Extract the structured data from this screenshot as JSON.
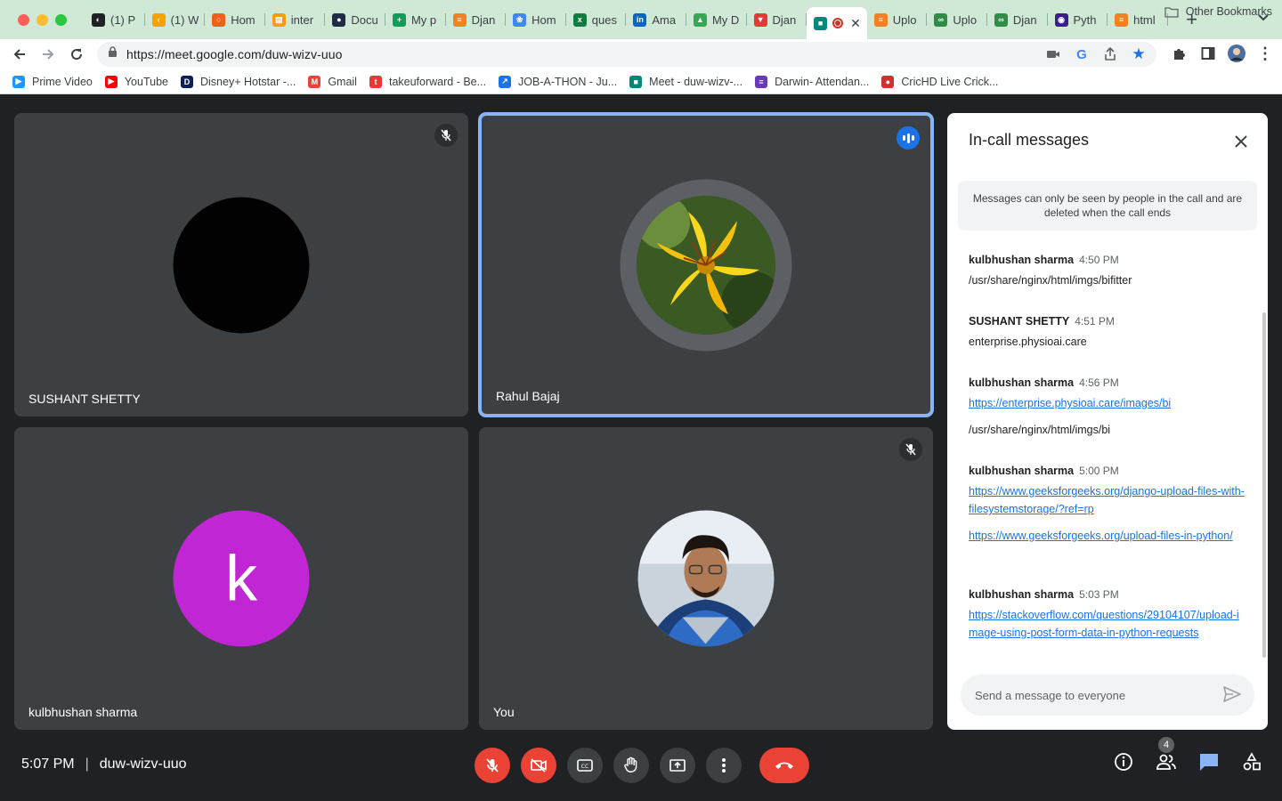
{
  "tabs": [
    {
      "title": "(1) P",
      "favicon_color": "#202124",
      "favicon_glyph": "◐"
    },
    {
      "title": "(1) W",
      "favicon_color": "#f4a300",
      "favicon_glyph": "‹"
    },
    {
      "title": "Hom",
      "favicon_color": "#f25f1a",
      "favicon_glyph": "○"
    },
    {
      "title": "inter",
      "favicon_color": "#f59e0b",
      "favicon_glyph": "▤"
    },
    {
      "title": "Docu",
      "favicon_color": "#1f2a44",
      "favicon_glyph": "●"
    },
    {
      "title": "My p",
      "favicon_color": "#0f9d58",
      "favicon_glyph": "+"
    },
    {
      "title": "Djan",
      "favicon_color": "#f48024",
      "favicon_glyph": "≡"
    },
    {
      "title": "Hom",
      "favicon_color": "#4285f4",
      "favicon_glyph": "❀"
    },
    {
      "title": "ques",
      "favicon_color": "#107c41",
      "favicon_glyph": "x"
    },
    {
      "title": "Ama",
      "favicon_color": "#0a66c2",
      "favicon_glyph": "in"
    },
    {
      "title": "My D",
      "favicon_color": "#34a853",
      "favicon_glyph": "▲"
    },
    {
      "title": "Djan",
      "favicon_color": "#e53935",
      "favicon_glyph": "▼"
    },
    {
      "title": "",
      "favicon_color": "#00897b",
      "favicon_glyph": "■",
      "active": true
    },
    {
      "title": "Uplo",
      "favicon_color": "#f48024",
      "favicon_glyph": "≡"
    },
    {
      "title": "Uplo",
      "favicon_color": "#2f8d46",
      "favicon_glyph": "∞"
    },
    {
      "title": "Djan",
      "favicon_color": "#2f8d46",
      "favicon_glyph": "∞"
    },
    {
      "title": "Pyth",
      "favicon_color": "#3b1c8c",
      "favicon_glyph": "◉"
    },
    {
      "title": "html",
      "favicon_color": "#f48024",
      "favicon_glyph": "≡"
    }
  ],
  "address_bar": {
    "url": "https://meet.google.com/duw-wizv-uuo"
  },
  "bookmarks": [
    {
      "label": "Prime Video",
      "favicon_color": "#1a98ff",
      "favicon_glyph": "▶"
    },
    {
      "label": "YouTube",
      "favicon_color": "#ff0000",
      "favicon_glyph": "▶"
    },
    {
      "label": "Disney+ Hotstar -...",
      "favicon_color": "#0c1f5a",
      "favicon_glyph": "D"
    },
    {
      "label": "Gmail",
      "favicon_color": "#ea4335",
      "favicon_glyph": "M"
    },
    {
      "label": "takeuforward - Be...",
      "favicon_color": "#e53935",
      "favicon_glyph": "t"
    },
    {
      "label": "JOB-A-THON - Ju...",
      "favicon_color": "#1a73e8",
      "favicon_glyph": "↗"
    },
    {
      "label": "Meet - duw-wizv-...",
      "favicon_color": "#00897b",
      "favicon_glyph": "■"
    },
    {
      "label": "Darwin- Attendan...",
      "favicon_color": "#673ab7",
      "favicon_glyph": "≡"
    },
    {
      "label": "CricHD Live Crick...",
      "favicon_color": "#d32f2f",
      "favicon_glyph": "●"
    }
  ],
  "other_bookmarks_label": "Other Bookmarks",
  "participants": [
    {
      "name": "SUSHANT SHETTY",
      "avatar_type": "image-dark",
      "muted": true,
      "speaking": false
    },
    {
      "name": "Rahul Bajaj",
      "avatar_type": "image-flower",
      "muted": false,
      "speaking": true
    },
    {
      "name": "kulbhushan sharma",
      "avatar_type": "letter",
      "avatar_letter": "k",
      "avatar_color": "#c026d3",
      "muted": false,
      "speaking": false
    },
    {
      "name": "You",
      "avatar_type": "image-photo",
      "muted": true,
      "speaking": false
    }
  ],
  "chat": {
    "title": "In-call messages",
    "notice": "Messages can only be seen by people in the call and are deleted when the call ends",
    "messages": [
      {
        "sender": "kulbhushan sharma",
        "time": "4:50 PM",
        "texts": [
          "/usr/share/nginx/html/imgs/bifitter"
        ],
        "links": []
      },
      {
        "sender": "SUSHANT SHETTY",
        "time": "4:51 PM",
        "texts": [
          "enterprise.physioai.care"
        ],
        "links": []
      },
      {
        "sender": "kulbhushan sharma",
        "time": "4:56 PM",
        "texts": [
          "/usr/share/nginx/html/imgs/bi"
        ],
        "links": [
          "https://enterprise.physioai.care/images/bi"
        ]
      },
      {
        "sender": "kulbhushan sharma",
        "time": "5:00 PM",
        "texts": [],
        "links": [
          "https://www.geeksforgeeks.org/django-upload-files-with-filesystemstorage/?ref=rp",
          "https://www.geeksforgeeks.org/upload-files-in-python/"
        ]
      },
      {
        "sender": "kulbhushan sharma",
        "time": "5:03 PM",
        "texts": [],
        "links": [
          "https://stackoverflow.com/questions/29104107/upload-image-using-post-form-data-in-python-requests"
        ]
      }
    ],
    "input_placeholder": "Send a message to everyone"
  },
  "meeting": {
    "time": "5:07 PM",
    "separator": "|",
    "code": "duw-wizv-uuo"
  },
  "people_count": "4",
  "colors": {
    "accent_blue": "#1a73e8",
    "end_call_red": "#ea4335",
    "tile_bg": "#3c4043",
    "meet_bg": "#202124"
  }
}
